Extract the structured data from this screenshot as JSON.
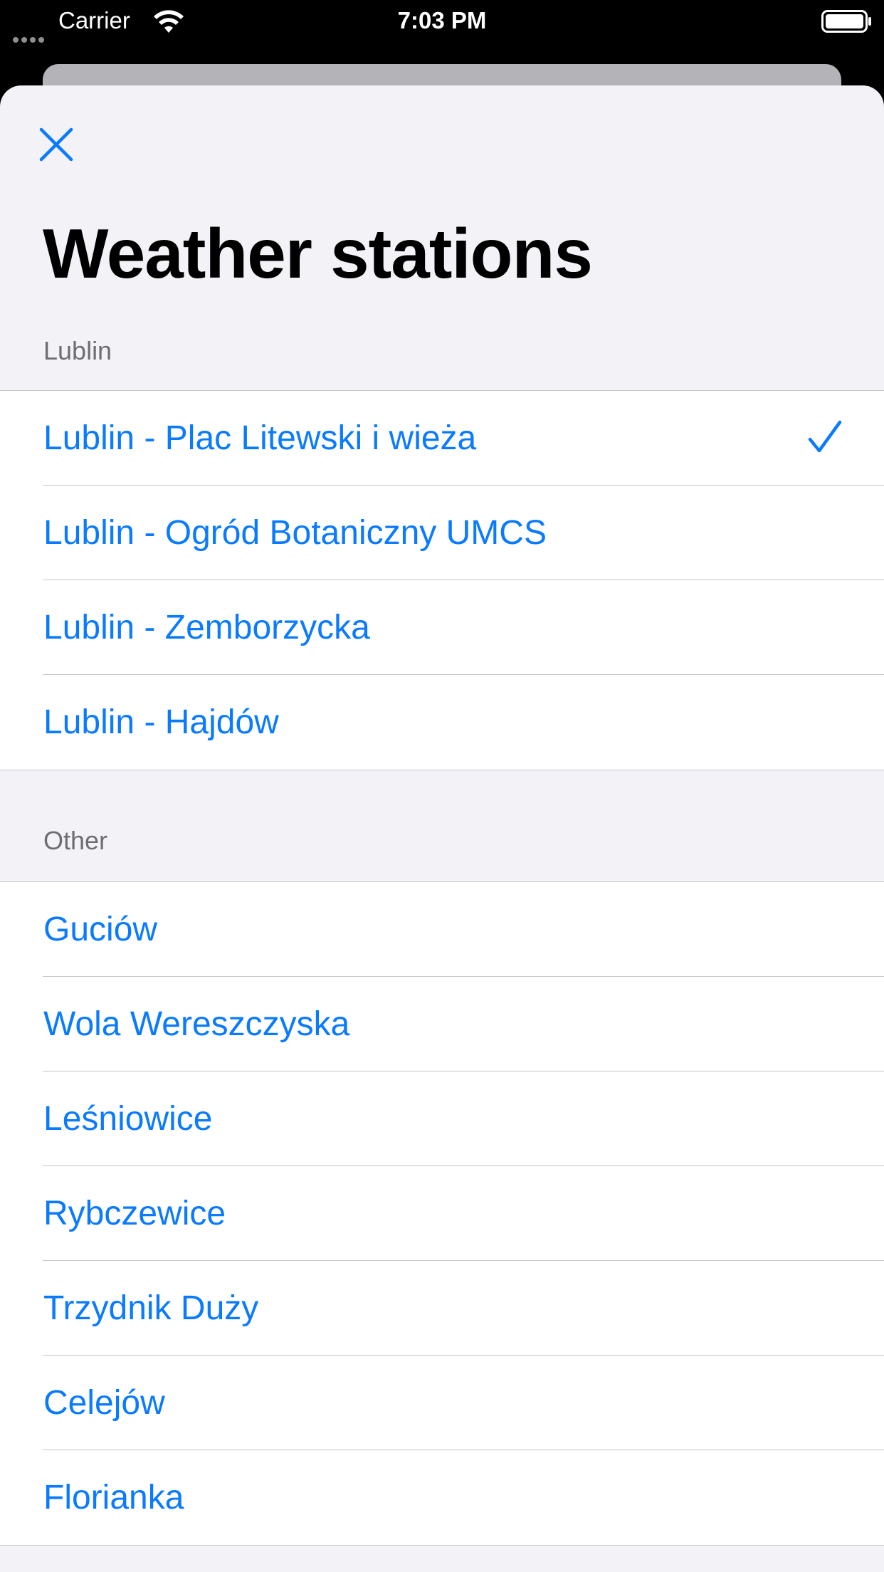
{
  "status_bar": {
    "carrier": "Carrier",
    "time": "7:03 PM"
  },
  "header": {
    "close_icon": "close-icon",
    "title": "Weather stations"
  },
  "colors": {
    "accent": "#0a7aff",
    "background": "#f2f2f7",
    "section_header": "#6d6d72"
  },
  "sections": [
    {
      "header": "Lublin",
      "items": [
        {
          "label": "Lublin - Plac Litewski i wieża",
          "selected": true
        },
        {
          "label": "Lublin - Ogród Botaniczny UMCS",
          "selected": false
        },
        {
          "label": "Lublin - Zemborzycka",
          "selected": false
        },
        {
          "label": "Lublin - Hajdów",
          "selected": false
        }
      ]
    },
    {
      "header": "Other",
      "items": [
        {
          "label": "Guciów"
        },
        {
          "label": "Wola Wereszczyska"
        },
        {
          "label": "Leśniowice"
        },
        {
          "label": "Rybczewice"
        },
        {
          "label": "Trzydnik Duży"
        },
        {
          "label": "Celejów"
        },
        {
          "label": "Florianka"
        }
      ]
    }
  ]
}
